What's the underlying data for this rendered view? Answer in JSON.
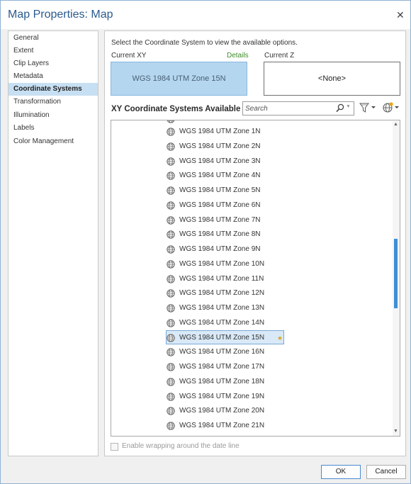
{
  "window": {
    "title": "Map Properties: Map"
  },
  "sidebar": {
    "items": [
      {
        "label": "General"
      },
      {
        "label": "Extent"
      },
      {
        "label": "Clip Layers"
      },
      {
        "label": "Metadata"
      },
      {
        "label": "Coordinate Systems",
        "selected": true
      },
      {
        "label": "Transformation"
      },
      {
        "label": "Illumination"
      },
      {
        "label": "Labels"
      },
      {
        "label": "Color Management"
      }
    ]
  },
  "panel": {
    "instruction": "Select the Coordinate System to view the available options.",
    "current_xy_label": "Current XY",
    "details_link": "Details",
    "current_z_label": "Current Z",
    "current_xy_value": "WGS 1984 UTM Zone 15N",
    "current_z_value": "<None>",
    "available_title": "XY Coordinate Systems Available",
    "search_placeholder": "Search",
    "list": [
      {
        "label": "WGS 1984 UTM Zone  1N"
      },
      {
        "label": "WGS 1984 UTM Zone  2N"
      },
      {
        "label": "WGS 1984 UTM Zone  3N"
      },
      {
        "label": "WGS 1984 UTM Zone  4N"
      },
      {
        "label": "WGS 1984 UTM Zone  5N"
      },
      {
        "label": "WGS 1984 UTM Zone  6N"
      },
      {
        "label": "WGS 1984 UTM Zone  7N"
      },
      {
        "label": "WGS 1984 UTM Zone  8N"
      },
      {
        "label": "WGS 1984 UTM Zone  9N"
      },
      {
        "label": "WGS 1984 UTM Zone 10N"
      },
      {
        "label": "WGS 1984 UTM Zone 11N"
      },
      {
        "label": "WGS 1984 UTM Zone 12N"
      },
      {
        "label": "WGS 1984 UTM Zone 13N"
      },
      {
        "label": "WGS 1984 UTM Zone 14N"
      },
      {
        "label": "WGS 1984 UTM Zone 15N",
        "selected": true
      },
      {
        "label": "WGS 1984 UTM Zone 16N"
      },
      {
        "label": "WGS 1984 UTM Zone 17N"
      },
      {
        "label": "WGS 1984 UTM Zone 18N"
      },
      {
        "label": "WGS 1984 UTM Zone 19N"
      },
      {
        "label": "WGS 1984 UTM Zone 20N"
      },
      {
        "label": "WGS 1984 UTM Zone 21N"
      }
    ],
    "wrap_label": "Enable wrapping around the date line",
    "wrap_checked": false
  },
  "buttons": {
    "ok": "OK",
    "cancel": "Cancel"
  },
  "colors": {
    "accent": "#2a5b8f",
    "selection": "#c7dff2",
    "link": "#3c8c2a",
    "scroll_thumb": "#3f8fd6"
  }
}
